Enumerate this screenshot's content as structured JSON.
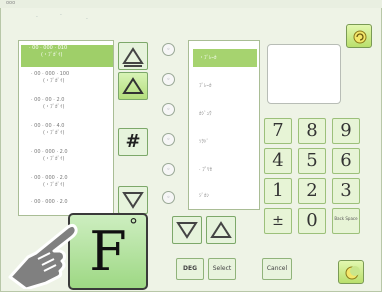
{
  "window": {
    "title": "ooo"
  },
  "list": {
    "items": [
      {
        "line1": "· 00 · 000 · 010",
        "line2": "(・ﾌﾞｶﾞｲ)",
        "selected": true
      },
      {
        "line1": "· 00 · 000 · 100",
        "line2": "(・ﾌﾞｶﾞｲ)",
        "selected": false
      },
      {
        "line1": "· 00 · 00 · 2.0",
        "line2": "(・ﾌﾞｶﾞｲ)",
        "selected": false
      },
      {
        "line1": "· 00 · 00 · 4.0",
        "line2": "(・ﾌﾞｶﾞｲ)",
        "selected": false
      },
      {
        "line1": "· 00 · 000 · 2.0",
        "line2": "(・ﾌﾞｶﾞｲ)",
        "selected": false
      },
      {
        "line1": "· 00 · 000 · 2.0",
        "line2": "(・ﾌﾞｶﾞｲ)",
        "selected": false
      },
      {
        "line1": "· 00 · 000 · 2.0",
        "line2": "",
        "selected": false
      }
    ]
  },
  "menu": {
    "items": [
      {
        "label": "・ﾌﾞﾚｰｶ",
        "selected": true
      },
      {
        "label": "ﾌﾞﾚｰｶ",
        "selected": false
      },
      {
        "label": "ｶｼﾞｭｳ",
        "selected": false
      },
      {
        "label": "ｿｸﾄﾞ",
        "selected": false
      },
      {
        "label": "· ﾌﾟﾘｾ",
        "selected": false
      },
      {
        "label": "ｼﾞｶﾝ",
        "selected": false
      }
    ]
  },
  "keypad": {
    "digits": [
      "7",
      "8",
      "9",
      "4",
      "5",
      "6",
      "1",
      "2",
      "3"
    ],
    "plus_minus": "±",
    "zero": "0",
    "backspace_label": "Back Space"
  },
  "side_buttons": {
    "hash": "#"
  },
  "bottom": {
    "deg_label": "DEG",
    "select_label": "Select",
    "cancel_label": "Cancel"
  },
  "overlay": {
    "letter": "F",
    "degree": "°"
  },
  "colors": {
    "accent": "#9fcf69",
    "panel_bg": "#eef3e6",
    "key_bg": "#e7f4d6"
  }
}
